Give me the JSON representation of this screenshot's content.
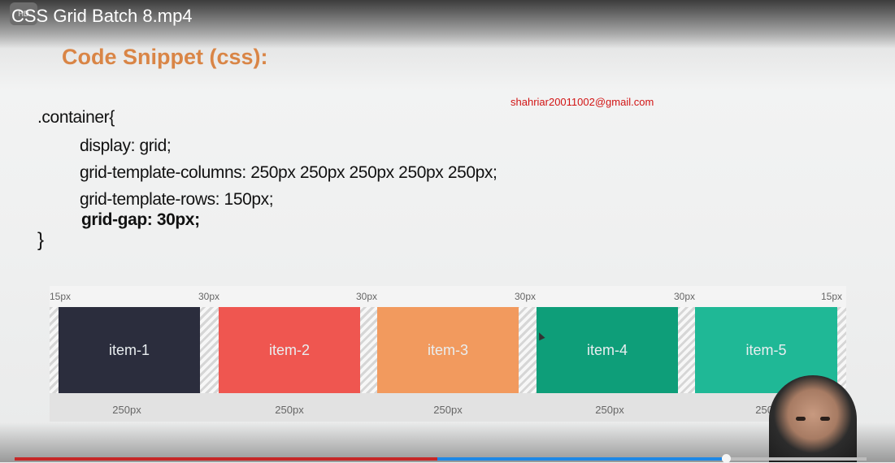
{
  "player": {
    "title": "CSS Grid Batch 8.mp4",
    "channel_chip": "HD",
    "progress_fraction": 0.83
  },
  "slide": {
    "heading": "Code Snippet (css):",
    "email": "shahriar20011002@gmail.com",
    "code_lines": [
      ".container{",
      "display: grid;",
      "grid-template-columns: 250px 250px 250px 250px 250px;",
      "grid-template-rows: 150px;",
      "grid-gap: 30px;",
      "}"
    ]
  },
  "diagram": {
    "gap_labels": [
      "15px",
      "30px",
      "30px",
      "30px",
      "30px",
      "15px"
    ],
    "items": [
      {
        "label": "item-1",
        "color": "#2b2d3d"
      },
      {
        "label": "item-2",
        "color": "#ef5650"
      },
      {
        "label": "item-3",
        "color": "#f29a5e"
      },
      {
        "label": "item-4",
        "color": "#0e9e79"
      },
      {
        "label": "item-5",
        "color": "#1fb896"
      }
    ],
    "size_labels": [
      "250px",
      "250px",
      "250px",
      "250px",
      "250px"
    ]
  }
}
